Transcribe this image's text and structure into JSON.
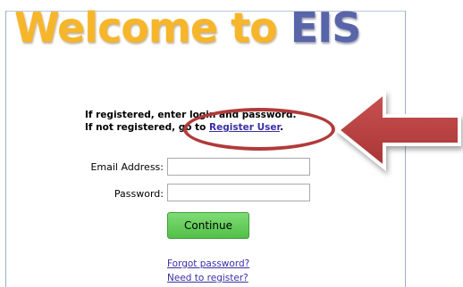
{
  "header": {
    "title_part1": "Welcome to ",
    "title_part2": "EIS"
  },
  "instructions": {
    "line1": "If registered, enter login and password.",
    "line2_prefix": "If not registered, go to ",
    "line2_link": "Register User",
    "line2_suffix": "."
  },
  "form": {
    "email_label": "Email Address:",
    "email_value": "",
    "password_label": "Password:",
    "password_value": "",
    "continue_label": "Continue"
  },
  "links": {
    "forgot": "Forgot password?",
    "register": "Need to register?"
  },
  "colors": {
    "welcome": "#f7b52a",
    "eis": "#5865a8",
    "callout": "#b13a3a",
    "button": "#5cc452",
    "link": "#3a2fa6"
  }
}
